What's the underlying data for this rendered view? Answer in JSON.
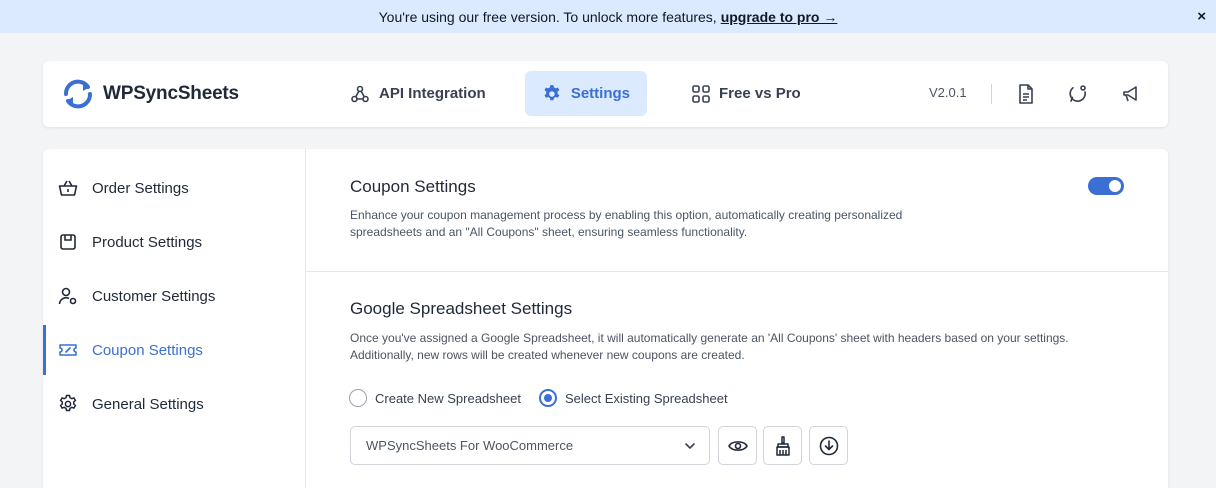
{
  "notice": {
    "text": "You're using our free version. To unlock more features,",
    "link": "upgrade to pro →",
    "close": "×"
  },
  "header": {
    "logo": "WPSyncSheets",
    "tabs": [
      {
        "label": "API Integration",
        "icon": "webhook-icon"
      },
      {
        "label": "Settings",
        "icon": "gear-icon",
        "active": true
      },
      {
        "label": "Free vs Pro",
        "icon": "grid-icon"
      }
    ],
    "version": "V2.0.1",
    "icons": [
      "document-icon",
      "chat-icon",
      "megaphone-icon"
    ]
  },
  "sidebar": {
    "items": [
      {
        "label": "Order Settings",
        "icon": "basket-icon"
      },
      {
        "label": "Product Settings",
        "icon": "box-icon"
      },
      {
        "label": "Customer Settings",
        "icon": "user-gear-icon"
      },
      {
        "label": "Coupon Settings",
        "icon": "ticket-icon",
        "active": true
      },
      {
        "label": "General Settings",
        "icon": "gear-icon"
      }
    ]
  },
  "coupon": {
    "title": "Coupon Settings",
    "desc_line1": "Enhance your coupon management process by enabling this option, automatically creating personalized",
    "desc_line2": "spreadsheets and an \"All Coupons\" sheet, ensuring seamless functionality.",
    "enabled": true
  },
  "spreadsheet": {
    "title": "Google Spreadsheet Settings",
    "desc_line1": "Once you've assigned a Google Spreadsheet, it will automatically generate an 'All Coupons' sheet with headers based on your settings.",
    "desc_line2": "Additionally, new rows will be created whenever new coupons are created.",
    "radio_new": "Create New Spreadsheet",
    "radio_existing": "Select Existing Spreadsheet",
    "selected_option": "existing",
    "select_value": "WPSyncSheets For WooCommerce"
  },
  "colors": {
    "accent": "#3b6fd4",
    "accent_bg": "#dbeafe"
  }
}
